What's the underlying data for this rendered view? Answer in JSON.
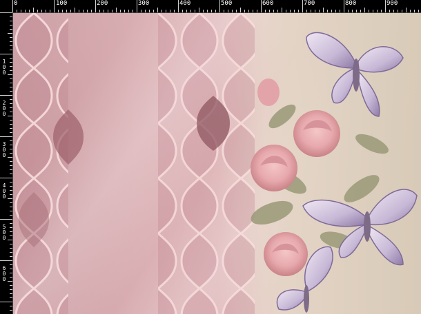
{
  "ruler": {
    "horizontal_labels": [
      "0",
      "100",
      "200",
      "300",
      "400",
      "500",
      "600",
      "700",
      "800",
      "900"
    ],
    "vertical_labels": [
      "1\n0\n0",
      "2\n0\n0",
      "3\n0\n0",
      "4\n0\n0",
      "5\n0\n0",
      "6\n0\n0"
    ]
  },
  "colors": {
    "ruler_bg": "#000000",
    "ruler_text": "#ffffff",
    "canvas_pink": "#d9aeb2",
    "rose": "#e7a9ad",
    "butterfly": "#b9a8c9",
    "leaf": "#9a9a78"
  },
  "canvas": {
    "description_icon": "image-canvas"
  }
}
